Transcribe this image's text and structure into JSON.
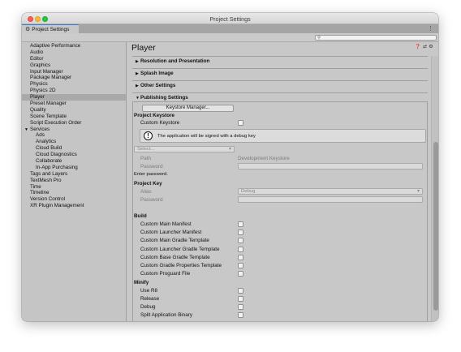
{
  "window": {
    "title": "Project Settings"
  },
  "tab": {
    "label": "Project Settings",
    "menu_glyph": "⋮"
  },
  "search": {
    "value": ""
  },
  "sidebar": {
    "items": [
      "Adaptive Performance",
      "Audio",
      "Editor",
      "Graphics",
      "Input Manager",
      "Package Manager",
      "Physics",
      "Physics 2D",
      "Player",
      "Preset Manager",
      "Quality",
      "Scene Template",
      "Script Execution Order"
    ],
    "selected": "Player",
    "services_label": "Services",
    "services_items": [
      "Ads",
      "Analytics",
      "Cloud Build",
      "Cloud Diagnostics",
      "Collaborate",
      "In-App Purchasing"
    ],
    "items_after": [
      "Tags and Layers",
      "TextMesh Pro",
      "Time",
      "Timeline",
      "Version Control",
      "XR Plugin Management"
    ]
  },
  "page": {
    "title": "Player"
  },
  "sections": {
    "resolution": "Resolution and Presentation",
    "splash": "Splash Image",
    "other": "Other Settings",
    "publishing": "Publishing Settings"
  },
  "publishing": {
    "keystore_manager_button": "Keystore Manager...",
    "project_keystore_heading": "Project Keystore",
    "custom_keystore_label": "Custom Keystore",
    "custom_keystore_checked": false,
    "info_message": "The application will be signed with a debug key",
    "select_placeholder": "Select...",
    "path_label": "Path",
    "path_value": "Development Keystore",
    "password_label": "Password",
    "enter_password_hint": "Enter password.",
    "project_key_heading": "Project Key",
    "alias_label": "Alias",
    "alias_value": "Debug",
    "key_password_label": "Password",
    "build_heading": "Build",
    "build_options": [
      "Custom Main Manifest",
      "Custom Launcher Manifest",
      "Custom Main Gradle Template",
      "Custom Launcher Gradle Template",
      "Custom Base Gradle Template",
      "Custom Gradle Properties Template",
      "Custom Proguard File"
    ],
    "minify_heading": "Minify",
    "minify_options": [
      "Use R8",
      "Release",
      "Debug"
    ],
    "split_binary_label": "Split Application Binary"
  },
  "colors": {
    "accent": "#3a79d6",
    "selected_row": "#a9a9a9"
  },
  "icons": {
    "settings": "gear-icon",
    "help": "help-icon",
    "presets": "presets-icon",
    "more": "gear-icon"
  }
}
